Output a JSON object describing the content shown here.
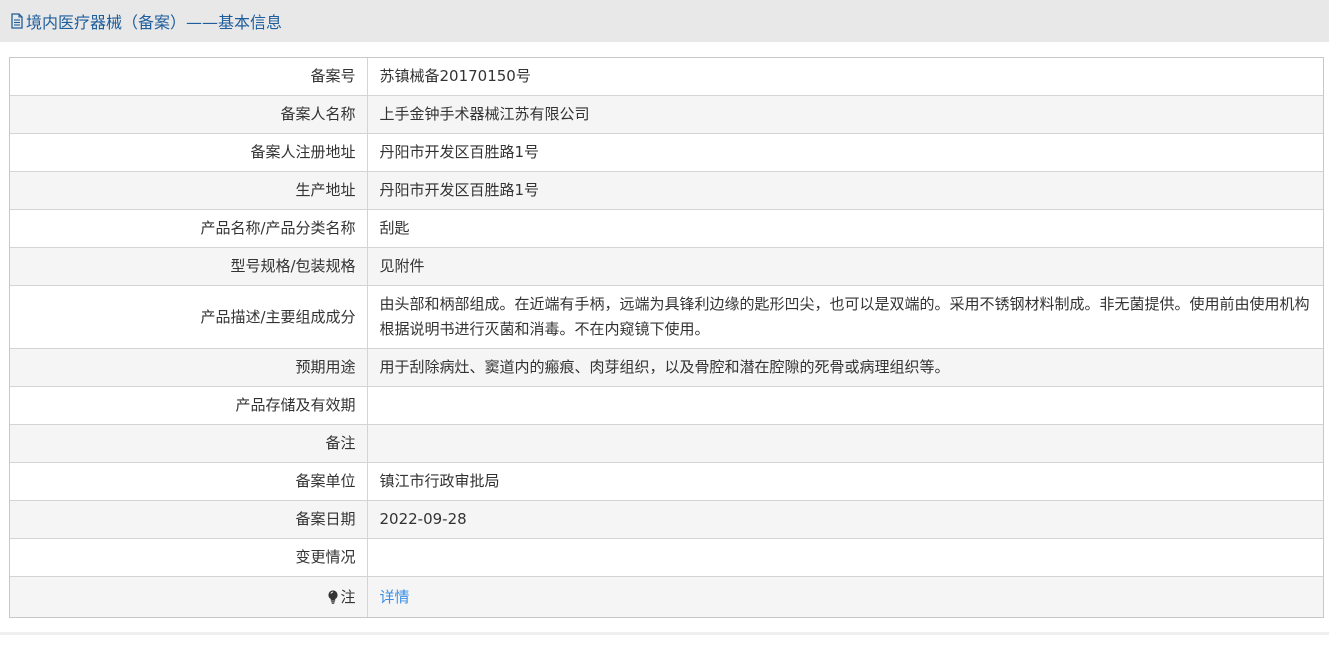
{
  "header": {
    "title": "境内医疗器械（备案）——基本信息",
    "icon": "document-icon",
    "title_color": "#1e5d9c"
  },
  "rows": [
    {
      "label": "备案号",
      "value": "苏镇械备20170150号"
    },
    {
      "label": "备案人名称",
      "value": "上手金钟手术器械江苏有限公司"
    },
    {
      "label": "备案人注册地址",
      "value": "丹阳市开发区百胜路1号"
    },
    {
      "label": "生产地址",
      "value": "丹阳市开发区百胜路1号"
    },
    {
      "label": "产品名称/产品分类名称",
      "value": "刮匙"
    },
    {
      "label": "型号规格/包装规格",
      "value": "见附件"
    },
    {
      "label": "产品描述/主要组成成分",
      "value": "由头部和柄部组成。在近端有手柄，远端为具锋利边缘的匙形凹尖，也可以是双端的。采用不锈钢材料制成。非无菌提供。使用前由使用机构根据说明书进行灭菌和消毒。不在内窥镜下使用。"
    },
    {
      "label": "预期用途",
      "value": "用于刮除病灶、窦道内的瘢痕、肉芽组织，以及骨腔和潜在腔隙的死骨或病理组织等。"
    },
    {
      "label": "产品存储及有效期",
      "value": ""
    },
    {
      "label": "备注",
      "value": ""
    },
    {
      "label": "备案单位",
      "value": "镇江市行政审批局"
    },
    {
      "label": "备案日期",
      "value": "2022-09-28"
    },
    {
      "label": "变更情况",
      "value": ""
    },
    {
      "label": "注",
      "value": "详情",
      "label_icon": "lightbulb-icon"
    }
  ],
  "colors": {
    "link": "#3a8ee6",
    "header_bg": "#e8e8e8",
    "row_alt_bg": "#f5f5f5"
  }
}
